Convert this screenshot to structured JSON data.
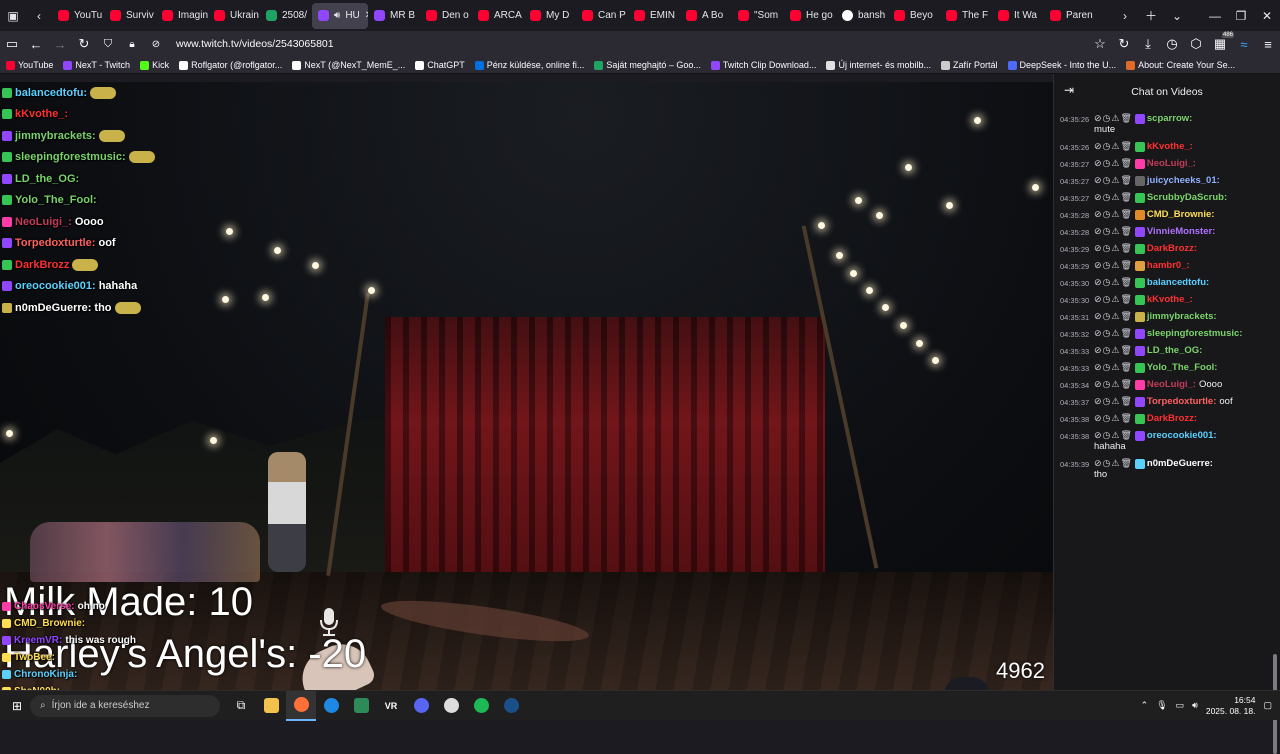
{
  "tabs": [
    {
      "label": "YouTu",
      "fav": "yt"
    },
    {
      "label": "Surviv",
      "fav": "yt"
    },
    {
      "label": "Imagin",
      "fav": "yt"
    },
    {
      "label": "Ukrain",
      "fav": "yt"
    },
    {
      "label": "2508/",
      "fav": "gs"
    },
    {
      "label": "HU",
      "fav": "tw",
      "active": true
    },
    {
      "label": "MR B",
      "fav": "tw"
    },
    {
      "label": "Den o",
      "fav": "yt"
    },
    {
      "label": "ARCA",
      "fav": "yt"
    },
    {
      "label": "My D",
      "fav": "yt"
    },
    {
      "label": "Can P",
      "fav": "yt"
    },
    {
      "label": "EMIN",
      "fav": "yt"
    },
    {
      "label": "A Bo",
      "fav": "yt"
    },
    {
      "label": "\"Som",
      "fav": "yt"
    },
    {
      "label": "He go",
      "fav": "yt"
    },
    {
      "label": "bansh",
      "fav": "gg"
    },
    {
      "label": "Beyo",
      "fav": "yt"
    },
    {
      "label": "The F",
      "fav": "yt"
    },
    {
      "label": "It Wa",
      "fav": "yt"
    },
    {
      "label": "Paren",
      "fav": "yt"
    }
  ],
  "nav": {
    "url": "www.twitch.tv/videos/2543065801",
    "badge_count": "486"
  },
  "bookmarks": [
    {
      "label": "YouTube",
      "color": "#ff0033"
    },
    {
      "label": "NexT - Twitch",
      "color": "#9146ff"
    },
    {
      "label": "Kick",
      "color": "#53fc18"
    },
    {
      "label": "Roflgator (@roflgator...",
      "color": "#ffffff"
    },
    {
      "label": "NexT (@NexT_MemE_...",
      "color": "#ffffff"
    },
    {
      "label": "ChatGPT",
      "color": "#ffffff"
    },
    {
      "label": "Pénz küldése, online fi...",
      "color": "#0070e0"
    },
    {
      "label": "Saját meghajtó – Goo...",
      "color": "#1ea362"
    },
    {
      "label": "Twitch Clip Download...",
      "color": "#9146ff"
    },
    {
      "label": "Új internet- és mobilb...",
      "color": "#e0e0e0"
    },
    {
      "label": "Zafír Portál",
      "color": "#cccccc"
    },
    {
      "label": "DeepSeek - Into the U...",
      "color": "#4d6bfe"
    },
    {
      "label": "About: Create Your Se...",
      "color": "#e06a2a"
    }
  ],
  "video_chat": [
    {
      "user": "balancedtofu:",
      "color": "#5ad1ff",
      "msg": "",
      "emote": true,
      "badge": "#36c455"
    },
    {
      "user": "kKvothe_:",
      "color": "#ff3030",
      "msg": "",
      "emote": false,
      "badge": "#36c455"
    },
    {
      "user": "jimmybrackets:",
      "color": "#7ad36a",
      "msg": "",
      "emote": true,
      "badge": "#9146ff"
    },
    {
      "user": "sleepingforestmusic:",
      "color": "#7ad36a",
      "msg": "",
      "emote": true,
      "badge": "#36c455"
    },
    {
      "user": "LD_the_OG:",
      "color": "#7ad36a",
      "msg": "",
      "emote": false,
      "badge": "#9146ff"
    },
    {
      "user": "Yolo_The_Fool:",
      "color": "#7ad36a",
      "msg": "",
      "emote": false,
      "badge": "#36c455"
    },
    {
      "user": "NeoLuigi_:",
      "color": "#c23c5a",
      "msg": "Oooo",
      "emote": false,
      "badge": "#ff3ca8"
    },
    {
      "user": "Torpedoxturtle:",
      "color": "#ff6060",
      "msg": "oof",
      "emote": false,
      "badge": "#9146ff"
    },
    {
      "user": "DarkBrozz",
      "color": "#ff3030",
      "msg": "",
      "emote": true,
      "badge": "#36c455"
    },
    {
      "user": "oreocookie001:",
      "color": "#5ad1ff",
      "msg": "hahaha",
      "emote": false,
      "badge": "#9146ff"
    },
    {
      "user": "n0mDeGuerre:",
      "color": "#ffffff",
      "msg": "tho",
      "emote": true,
      "badge": "#c9b24a"
    }
  ],
  "overlay": {
    "line1": "Milk Made: 10",
    "line2": "Harley's Angel's: -20",
    "score": "4962"
  },
  "bottom_chat": [
    {
      "user": "ChaosVerse:",
      "color": "#ff3ca8",
      "msg": "oh no"
    },
    {
      "user": "CMD_Brownie:",
      "color": "#ffdd55",
      "msg": ""
    },
    {
      "user": "KreemVR:",
      "color": "#9146ff",
      "msg": "this was rough"
    },
    {
      "user": "TwoBee:",
      "color": "#ffdd55",
      "msg": ""
    },
    {
      "user": "ChronoKinja:",
      "color": "#5ad1ff",
      "msg": ""
    },
    {
      "user": "SheN00b:",
      "color": "#ffdd55",
      "msg": ""
    }
  ],
  "chat_panel": {
    "title": "Chat on Videos",
    "messages": [
      {
        "ts": "04:35:26",
        "user": "scparrow:",
        "color": "#7ad36a",
        "badge": "#9146ff",
        "body": "",
        "cont": "mute"
      },
      {
        "ts": "04:35:26",
        "user": "kKvothe_:",
        "color": "#ff3030",
        "badge": "#36c455",
        "body": "",
        "cont": ""
      },
      {
        "ts": "04:35:27",
        "user": "NeoLuigi_:",
        "color": "#c23c5a",
        "badge": "#ff3ca8",
        "body": "",
        "cont": ""
      },
      {
        "ts": "04:35:27",
        "user": "juicycheeks_01:",
        "color": "#8fb0ff",
        "badge": "#666",
        "body": "",
        "cont": ""
      },
      {
        "ts": "04:35:27",
        "user": "ScrubbyDaScrub:",
        "color": "#7ad36a",
        "badge": "#36c455",
        "body": "",
        "cont": ""
      },
      {
        "ts": "04:35:28",
        "user": "CMD_Brownie:",
        "color": "#ffdd55",
        "badge": "#e08a2a",
        "body": "",
        "cont": ""
      },
      {
        "ts": "04:35:28",
        "user": "VinnieMonster:",
        "color": "#b070ff",
        "badge": "#9146ff",
        "body": "",
        "cont": ""
      },
      {
        "ts": "04:35:29",
        "user": "DarkBrozz:",
        "color": "#ff3030",
        "badge": "#36c455",
        "body": "",
        "cont": ""
      },
      {
        "ts": "04:35:29",
        "user": "hambr0_:",
        "color": "#ff3030",
        "badge": "#e0a040",
        "body": "",
        "cont": ""
      },
      {
        "ts": "04:35:30",
        "user": "balancedtofu:",
        "color": "#5ad1ff",
        "badge": "#36c455",
        "body": "",
        "cont": ""
      },
      {
        "ts": "04:35:30",
        "user": "kKvothe_:",
        "color": "#ff3030",
        "badge": "#36c455",
        "body": "",
        "cont": ""
      },
      {
        "ts": "04:35:31",
        "user": "jimmybrackets:",
        "color": "#7ad36a",
        "badge": "#c9b24a",
        "body": "",
        "cont": ""
      },
      {
        "ts": "04:35:32",
        "user": "sleepingforestmusic:",
        "color": "#7ad36a",
        "badge": "#9146ff",
        "body": "",
        "cont": ""
      },
      {
        "ts": "04:35:33",
        "user": "LD_the_OG:",
        "color": "#7ad36a",
        "badge": "#9146ff",
        "body": "",
        "cont": ""
      },
      {
        "ts": "04:35:33",
        "user": "Yolo_The_Fool:",
        "color": "#7ad36a",
        "badge": "#36c455",
        "body": "",
        "cont": ""
      },
      {
        "ts": "04:35:34",
        "user": "NeoLuigi_:",
        "color": "#c23c5a",
        "badge": "#ff3ca8",
        "body": "Oooo",
        "cont": ""
      },
      {
        "ts": "04:35:37",
        "user": "Torpedoxturtle:",
        "color": "#ff6060",
        "badge": "#9146ff",
        "body": "oof",
        "cont": ""
      },
      {
        "ts": "04:35:38",
        "user": "DarkBrozz:",
        "color": "#ff3030",
        "badge": "#36c455",
        "body": "",
        "cont": ""
      },
      {
        "ts": "04:35:38",
        "user": "oreocookie001:",
        "color": "#5ad1ff",
        "badge": "#9146ff",
        "body": "",
        "cont": "hahaha"
      },
      {
        "ts": "04:35:39",
        "user": "n0mDeGuerre:",
        "color": "#ffffff",
        "badge": "#5ad1ff",
        "body": "",
        "cont": "tho"
      }
    ]
  },
  "taskbar": {
    "search_placeholder": "Írjon ide a kereséshez",
    "time": "16:54",
    "date": "2025. 08. 18."
  }
}
